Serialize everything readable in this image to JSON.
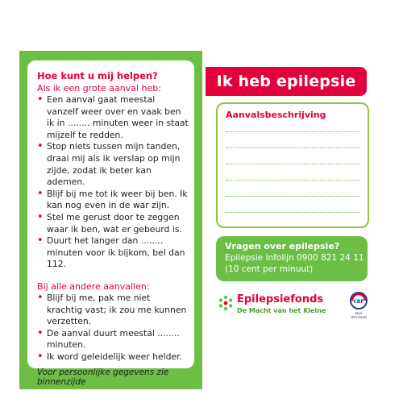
{
  "left_card": {
    "heading": "Hoe kunt u mij helpen?",
    "sub_big": "Als ik een grote aanval heb:",
    "big_items": [
      "Een aanval gaat meestal vanzelf weer over en vaak ben ik in ........ minuten weer in staat mijzelf te redden.",
      "Stop niets tussen mijn tanden, draai mij als ik verslap op mijn zijde, zodat ik beter kan ademen.",
      "Blijf bij me tot ik weer bij ben. Ik kan nog even in de war zijn.",
      "Stel me gerust door te zeggen waar ik ben, wat er gebeurd is.",
      "Duurt het langer dan ........ minuten voor ik bijkom, bel dan 112."
    ],
    "sub_other": "Bij alle andere aanvallen:",
    "other_items": [
      "Blijf bij me, pak me niet krachtig vast; ik zou me kunnen verzetten.",
      "De aanval duurt meestal ........ minuten.",
      "Ik word geleidelijk weer helder."
    ],
    "footer": "Voor persoonlijke gegevens zie binnenzijde"
  },
  "right_card": {
    "title": "Ik heb epilepsie",
    "description_label": "Aanvalsbeschrijving",
    "info": {
      "heading": "Vragen over epilepsie?",
      "line1": "Epilepsie Infolijn 0900 821 24 11",
      "line2": "(10 cent per minuut)"
    },
    "brand": {
      "name": "Epilepsiefonds",
      "tagline": "De Macht van het Kleine"
    },
    "cbf": {
      "label": "CBF",
      "caption": "keur\ncbf.nl/seal"
    }
  },
  "colors": {
    "green": "#6cbe45",
    "red": "#e4003b",
    "border_green": "#8dc63f"
  },
  "icons": [
    "epilepsiefonds-logo-icon",
    "cbf-seal-icon"
  ]
}
